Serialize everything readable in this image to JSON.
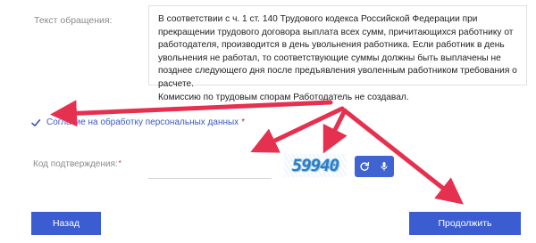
{
  "appeal": {
    "label": "Текст обращения:",
    "text": "В соответствии с ч. 1 ст. 140 Трудового кодекса Российской Федерации при прекращении трудового договора выплата всех сумм, причитающихся работнику от работодателя, производится в день увольнения работника. Если работник в день увольнения не работал, то соответствующие суммы должны быть выплачены не позднее следующего дня после предъявления уволенным работником требования о расчете.\nКомиссию по трудовым спорам Работодатель не создавал."
  },
  "consent": {
    "label": "Согласие на обработку персональных данных",
    "required": "*",
    "checked": true
  },
  "confirmation": {
    "label": "Код подтверждения:",
    "required": "*",
    "value": "",
    "captcha_text": "59940"
  },
  "captcha_controls": {
    "refresh_icon": "refresh-icon",
    "audio_icon": "microphone-icon"
  },
  "buttons": {
    "back": "Назад",
    "next": "Продолжить"
  },
  "colors": {
    "accent": "#3b5dd1",
    "arrow": "#e5304f",
    "required": "#e02424",
    "link": "#3a56c6"
  }
}
